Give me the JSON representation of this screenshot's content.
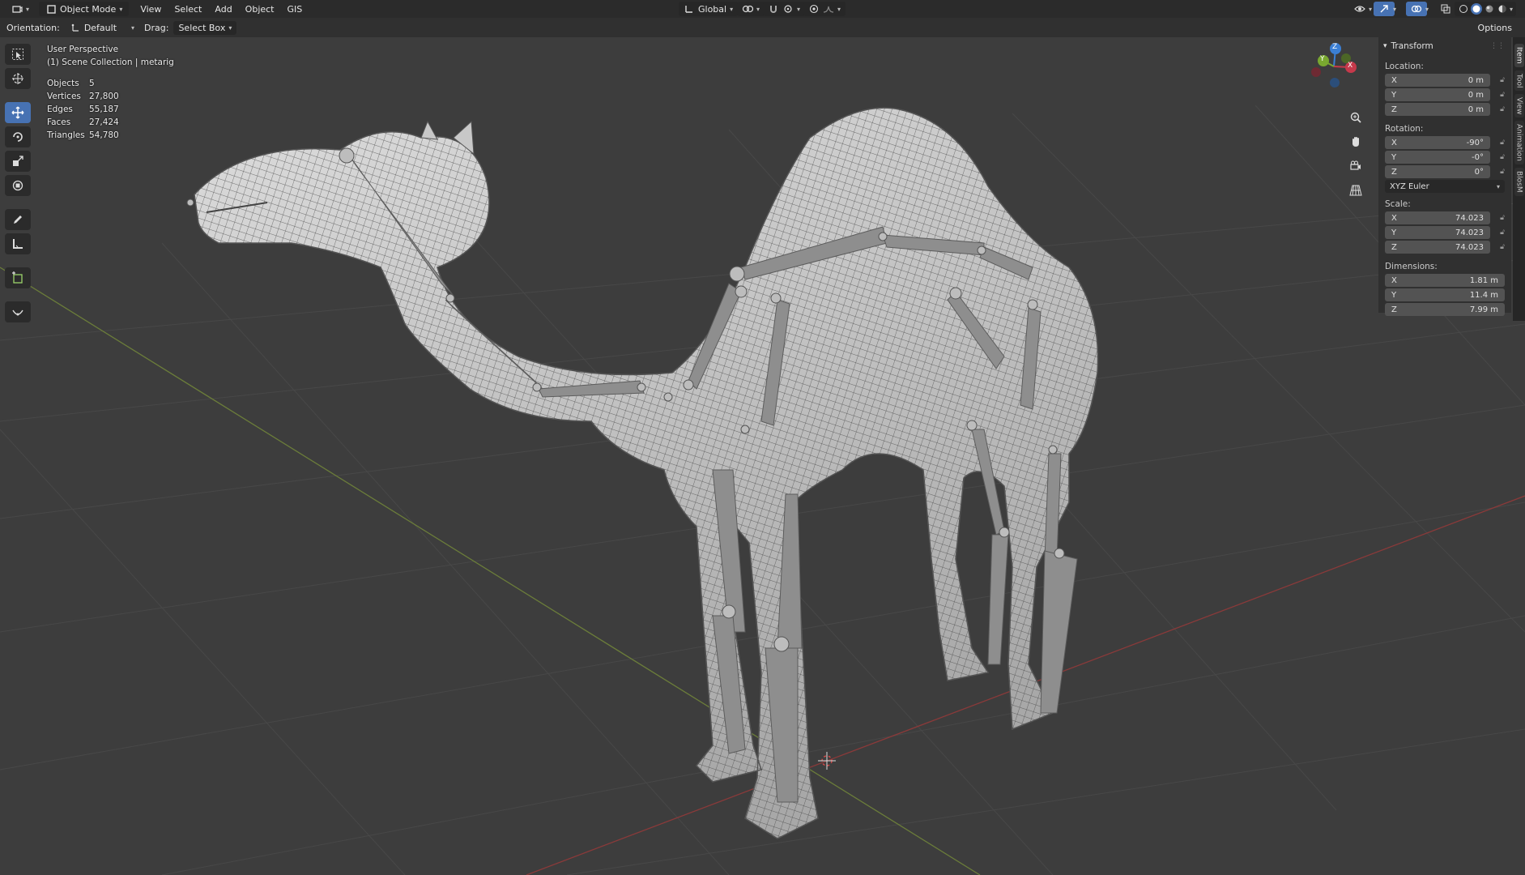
{
  "header": {
    "editor_type_icon": "viewport-editor-icon",
    "mode": "Object Mode",
    "menus": [
      "View",
      "Select",
      "Add",
      "Object",
      "GIS"
    ],
    "transform_orientation": "Global"
  },
  "tool_settings": {
    "orientation_label": "Orientation:",
    "orientation_value": "Default",
    "drag_label": "Drag:",
    "drag_value": "Select Box",
    "options_label": "Options"
  },
  "viewport": {
    "view_name": "User Perspective",
    "collection": "(1) Scene Collection | metarig",
    "stats": [
      {
        "label": "Objects",
        "value": "5"
      },
      {
        "label": "Vertices",
        "value": "27,800"
      },
      {
        "label": "Edges",
        "value": "55,187"
      },
      {
        "label": "Faces",
        "value": "27,424"
      },
      {
        "label": "Triangles",
        "value": "54,780"
      }
    ]
  },
  "gizmo": {
    "x": "X",
    "y": "Y",
    "z": "Z"
  },
  "colors": {
    "x_axis": "#c6394b",
    "y_axis": "#79a830",
    "z_axis": "#3b7fd4",
    "accent": "#4772b3"
  },
  "n_panel": {
    "title": "Transform",
    "location": {
      "label": "Location:",
      "x": "0 m",
      "y": "0 m",
      "z": "0 m"
    },
    "rotation": {
      "label": "Rotation:",
      "x": "-90°",
      "y": "-0°",
      "z": "0°",
      "mode": "XYZ Euler"
    },
    "scale": {
      "label": "Scale:",
      "x": "74.023",
      "y": "74.023",
      "z": "74.023"
    },
    "dimensions": {
      "label": "Dimensions:",
      "x": "1.81 m",
      "y": "11.4 m",
      "z": "7.99 m"
    },
    "axis_labels": {
      "x": "X",
      "y": "Y",
      "z": "Z"
    },
    "tabs": [
      "Item",
      "Tool",
      "View",
      "Animation",
      "BlosM"
    ]
  }
}
